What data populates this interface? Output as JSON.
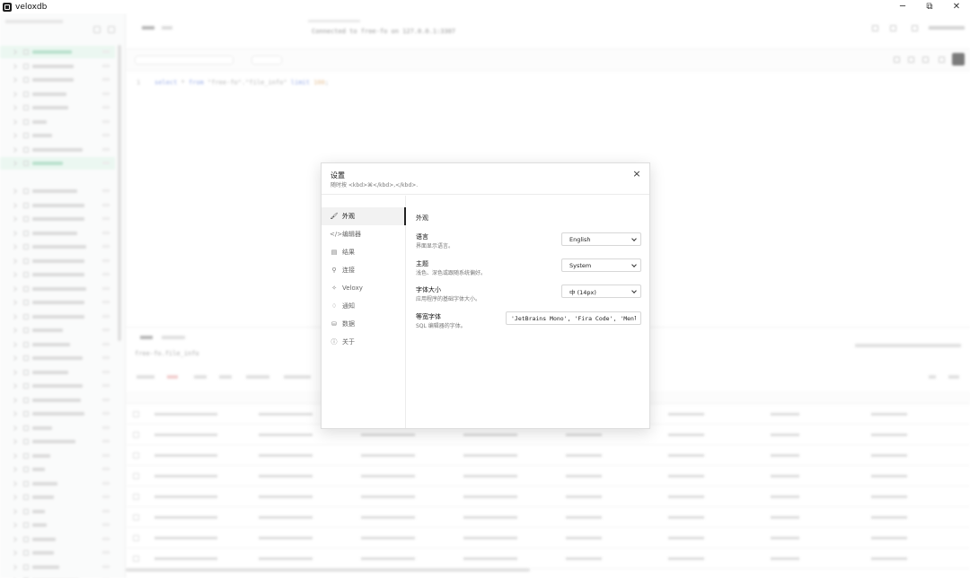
{
  "window": {
    "title": "veloxdb",
    "minimize_glyph": "─",
    "maximize_glyph": "⧉",
    "close_glyph": "✕"
  },
  "editor": {
    "line_number": "1",
    "sql_select": "select",
    "sql_star": "*",
    "sql_from": "from",
    "sql_table": "\"free-fo\".\"file_info\"",
    "sql_limit": "limit",
    "sql_limit_value": "100",
    "sql_end": ";",
    "connection_text": "Connected to free-fo on 127.0.0.1:3307"
  },
  "results": {
    "subtitle": "free-fo.file_info"
  },
  "settings": {
    "title": "设置",
    "hint": "随时按 <kbd>⌘</kbd>,</kbd>.",
    "close_label": "×",
    "nav": [
      {
        "label": "外观",
        "icon": "brush-icon",
        "glyph": "🖌"
      },
      {
        "label": "编辑器",
        "icon": "code-icon",
        "glyph": "</>"
      },
      {
        "label": "结果",
        "icon": "table-icon",
        "glyph": "▤"
      },
      {
        "label": "连接",
        "icon": "plug-icon",
        "glyph": "⚲"
      },
      {
        "label": "Veloxy",
        "icon": "sparkle-icon",
        "glyph": "✧"
      },
      {
        "label": "通知",
        "icon": "bell-icon",
        "glyph": "♢"
      },
      {
        "label": "数据",
        "icon": "database-icon",
        "glyph": "⛁"
      },
      {
        "label": "关于",
        "icon": "info-icon",
        "glyph": "ⓘ"
      }
    ],
    "section_title": "外观",
    "language": {
      "label": "语言",
      "desc": "界面显示语言。",
      "value": "English"
    },
    "theme": {
      "label": "主题",
      "desc": "浅色、深色或跟随系统偏好。",
      "value": "System"
    },
    "font_size": {
      "label": "字体大小",
      "desc": "应用程序的基础字体大小。",
      "value": "中 (14px)"
    },
    "mono_font": {
      "label": "等宽字体",
      "desc": "SQL 编辑器的字体。",
      "value": "'JetBrains Mono', 'Fira Code', 'Menlo', monospace"
    }
  }
}
